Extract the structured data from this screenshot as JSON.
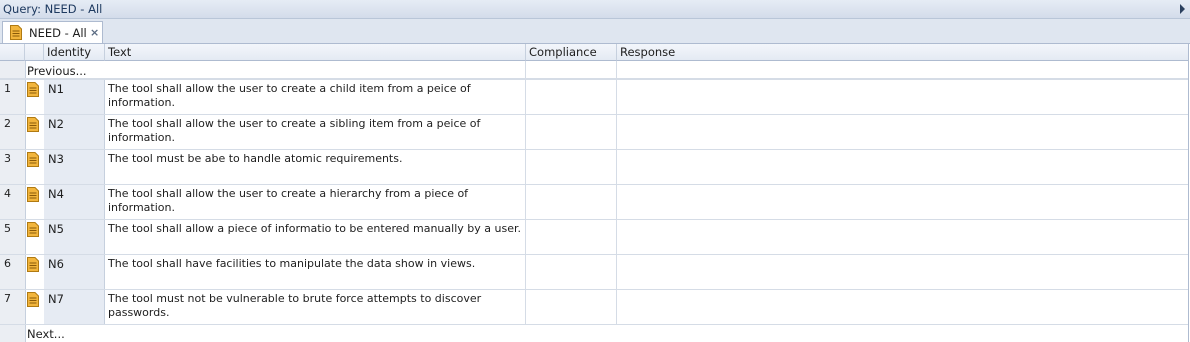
{
  "window": {
    "title": "Query: NEED - All"
  },
  "tab": {
    "label": "NEED - All",
    "close_glyph": "×",
    "icon": "document-icon"
  },
  "columns": {
    "identity": "Identity",
    "text": "Text",
    "compliance": "Compliance",
    "response": "Response"
  },
  "nav": {
    "previous": "Previous...",
    "next": "Next..."
  },
  "rows": [
    {
      "num": "1",
      "identity": "N1",
      "text": "The tool shall allow the user to create a child item from a peice of information.",
      "compliance": "",
      "response": ""
    },
    {
      "num": "2",
      "identity": "N2",
      "text": "The tool shall allow the user to create a sibling item from a peice of information.",
      "compliance": "",
      "response": ""
    },
    {
      "num": "3",
      "identity": "N3",
      "text": "The tool must be abe to handle atomic requirements.",
      "compliance": "",
      "response": ""
    },
    {
      "num": "4",
      "identity": "N4",
      "text": "The tool shall allow the user to create a hierarchy from a piece of information.",
      "compliance": "",
      "response": ""
    },
    {
      "num": "5",
      "identity": "N5",
      "text": "The tool shall allow a piece of informatio to be entered manually by a user.",
      "compliance": "",
      "response": ""
    },
    {
      "num": "6",
      "identity": "N6",
      "text": "The tool shall have facilities to manipulate the data show in views.",
      "compliance": "",
      "response": ""
    },
    {
      "num": "7",
      "identity": "N7",
      "text": "The tool must not be vulnerable to brute force attempts to discover passwords.",
      "compliance": "",
      "response": ""
    }
  ],
  "colors": {
    "header_bg": "#e4eaf3",
    "icon_fill": "#f2b53c"
  }
}
